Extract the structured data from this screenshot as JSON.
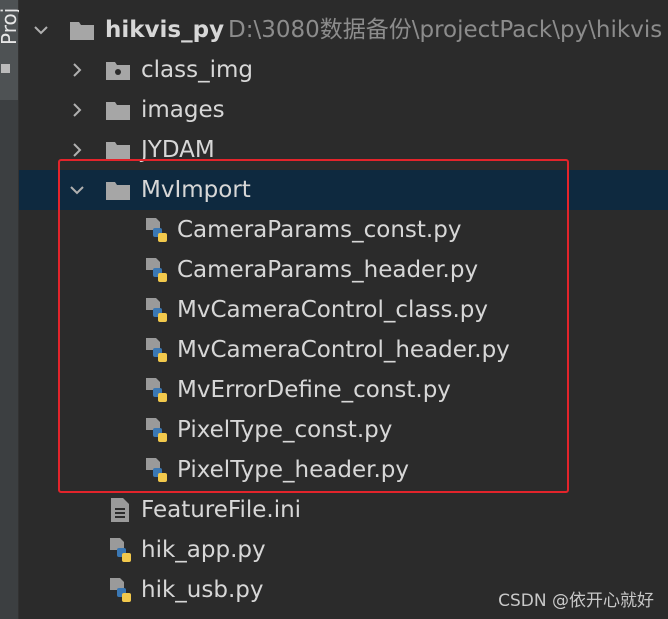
{
  "side_panel": {
    "tab_label": "Proj"
  },
  "project": {
    "name": "hikvis_py",
    "path": "D:\\3080数据备份\\projectPack\\py\\hikvis"
  },
  "tree": {
    "folders": {
      "class_img": "class_img",
      "images": "images",
      "jydam": "JYDAM",
      "mvimport": "MvImport"
    },
    "mvimport_files": [
      "CameraParams_const.py",
      "CameraParams_header.py",
      "MvCameraControl_class.py",
      "MvCameraControl_header.py",
      "MvErrorDefine_const.py",
      "PixelType_const.py",
      "PixelType_header.py"
    ],
    "root_files": [
      "FeatureFile.ini",
      "hik_app.py",
      "hik_usb.py"
    ]
  },
  "colors": {
    "highlight_border": "#e3242b",
    "selected_row": "#0e293f",
    "folder_icon": "#a6a6a6",
    "python_blue": "#3a77b3",
    "python_yellow": "#f2c94c"
  },
  "icons": {
    "folder": "folder-icon",
    "image_folder": "image-folder-icon",
    "python_file": "python-file-icon",
    "text_file": "text-file-icon"
  },
  "watermark": "CSDN @依开心就好"
}
